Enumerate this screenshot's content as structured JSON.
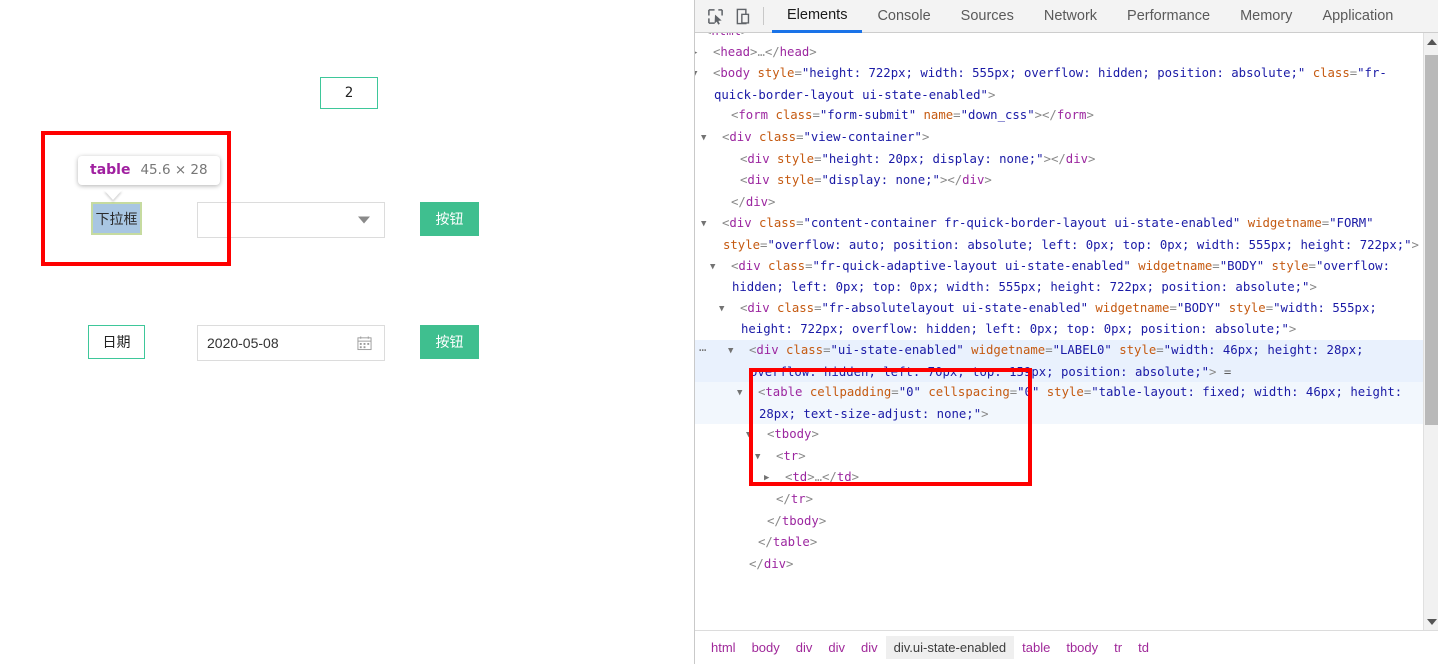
{
  "page": {
    "number_box_value": "2",
    "dropdown_row": {
      "label": "下拉框",
      "select_value": "",
      "caret_icon": "chevron-down-icon",
      "button_label": "按钮"
    },
    "date_row": {
      "label": "日期",
      "date_value": "2020-05-08",
      "calendar_icon": "calendar-icon",
      "button_label": "按钮"
    },
    "inspect_tooltip": {
      "tag": "table",
      "dimensions": "45.6 × 28"
    }
  },
  "devtools": {
    "toolbar": {
      "inspect_icon": "inspect-element-icon",
      "device_icon": "device-toolbar-icon"
    },
    "tabs": [
      {
        "label": "Elements",
        "active": true
      },
      {
        "label": "Console",
        "active": false
      },
      {
        "label": "Sources",
        "active": false
      },
      {
        "label": "Network",
        "active": false
      },
      {
        "label": "Performance",
        "active": false
      },
      {
        "label": "Memory",
        "active": false
      },
      {
        "label": "Application",
        "active": false
      }
    ],
    "dom_lines": [
      {
        "id": "html-cut",
        "indent": 0,
        "triangle": "",
        "parts": [
          {
            "t": "punc",
            "v": "<"
          },
          {
            "t": "tag",
            "v": "html"
          },
          {
            "t": "punc",
            "v": ">"
          }
        ],
        "clipped_top": true
      },
      {
        "id": "head",
        "indent": 1,
        "triangle": "▶",
        "parts": [
          {
            "t": "punc",
            "v": "<"
          },
          {
            "t": "tag",
            "v": "head"
          },
          {
            "t": "punc",
            "v": ">"
          },
          {
            "t": "ellip",
            "v": "…"
          },
          {
            "t": "punc",
            "v": "</"
          },
          {
            "t": "tag",
            "v": "head"
          },
          {
            "t": "punc",
            "v": ">"
          }
        ]
      },
      {
        "id": "body",
        "indent": 1,
        "triangle": "▼",
        "parts": [
          {
            "t": "punc",
            "v": "<"
          },
          {
            "t": "tag",
            "v": "body"
          },
          {
            "t": "plain",
            "v": " "
          },
          {
            "t": "attr",
            "v": "style"
          },
          {
            "t": "punc",
            "v": "="
          },
          {
            "t": "val",
            "v": "\"height: 722px; width: 555px; overflow: hidden; position: absolute;\""
          },
          {
            "t": "plain",
            "v": " "
          },
          {
            "t": "attr",
            "v": "class"
          },
          {
            "t": "punc",
            "v": "="
          },
          {
            "t": "val",
            "v": "\"fr-quick-border-layout ui-state-enabled\""
          },
          {
            "t": "punc",
            "v": ">"
          }
        ]
      },
      {
        "id": "form",
        "indent": 3,
        "triangle": "",
        "parts": [
          {
            "t": "punc",
            "v": "<"
          },
          {
            "t": "tag",
            "v": "form"
          },
          {
            "t": "plain",
            "v": " "
          },
          {
            "t": "attr",
            "v": "class"
          },
          {
            "t": "punc",
            "v": "="
          },
          {
            "t": "val",
            "v": "\"form-submit\""
          },
          {
            "t": "plain",
            "v": " "
          },
          {
            "t": "attr",
            "v": "name"
          },
          {
            "t": "punc",
            "v": "="
          },
          {
            "t": "val",
            "v": "\"down_css\""
          },
          {
            "t": "punc",
            "v": ">"
          },
          {
            "t": "punc",
            "v": "</"
          },
          {
            "t": "tag",
            "v": "form"
          },
          {
            "t": "punc",
            "v": ">"
          }
        ]
      },
      {
        "id": "view-container",
        "indent": 2,
        "triangle": "▼",
        "parts": [
          {
            "t": "punc",
            "v": "<"
          },
          {
            "t": "tag",
            "v": "div"
          },
          {
            "t": "plain",
            "v": " "
          },
          {
            "t": "attr",
            "v": "class"
          },
          {
            "t": "punc",
            "v": "="
          },
          {
            "t": "val",
            "v": "\"view-container\""
          },
          {
            "t": "punc",
            "v": ">"
          }
        ]
      },
      {
        "id": "div-h20",
        "indent": 4,
        "triangle": "",
        "parts": [
          {
            "t": "punc",
            "v": "<"
          },
          {
            "t": "tag",
            "v": "div"
          },
          {
            "t": "plain",
            "v": " "
          },
          {
            "t": "attr",
            "v": "style"
          },
          {
            "t": "punc",
            "v": "="
          },
          {
            "t": "val",
            "v": "\"height: 20px; display: none;\""
          },
          {
            "t": "punc",
            "v": ">"
          },
          {
            "t": "punc",
            "v": "</"
          },
          {
            "t": "tag",
            "v": "div"
          },
          {
            "t": "punc",
            "v": ">"
          }
        ]
      },
      {
        "id": "div-none",
        "indent": 4,
        "triangle": "",
        "parts": [
          {
            "t": "punc",
            "v": "<"
          },
          {
            "t": "tag",
            "v": "div"
          },
          {
            "t": "plain",
            "v": " "
          },
          {
            "t": "attr",
            "v": "style"
          },
          {
            "t": "punc",
            "v": "="
          },
          {
            "t": "val",
            "v": "\"display: none;\""
          },
          {
            "t": "punc",
            "v": ">"
          },
          {
            "t": "punc",
            "v": "</"
          },
          {
            "t": "tag",
            "v": "div"
          },
          {
            "t": "punc",
            "v": ">"
          }
        ]
      },
      {
        "id": "close-view-container",
        "indent": 3,
        "triangle": "",
        "parts": [
          {
            "t": "punc",
            "v": "</"
          },
          {
            "t": "tag",
            "v": "div"
          },
          {
            "t": "punc",
            "v": ">"
          }
        ]
      },
      {
        "id": "content-container",
        "indent": 2,
        "triangle": "▼",
        "parts": [
          {
            "t": "punc",
            "v": "<"
          },
          {
            "t": "tag",
            "v": "div"
          },
          {
            "t": "plain",
            "v": " "
          },
          {
            "t": "attr",
            "v": "class"
          },
          {
            "t": "punc",
            "v": "="
          },
          {
            "t": "val",
            "v": "\"content-container fr-quick-border-layout ui-state-enabled\""
          },
          {
            "t": "plain",
            "v": " "
          },
          {
            "t": "attr",
            "v": "widgetname"
          },
          {
            "t": "punc",
            "v": "="
          },
          {
            "t": "val",
            "v": "\"FORM\""
          },
          {
            "t": "plain",
            "v": " "
          },
          {
            "t": "attr",
            "v": "style"
          },
          {
            "t": "punc",
            "v": "="
          },
          {
            "t": "val",
            "v": "\"overflow: auto; position: absolute; left: 0px; top: 0px; width: 555px; height: 722px;\""
          },
          {
            "t": "punc",
            "v": ">"
          }
        ]
      },
      {
        "id": "adaptive-layout",
        "indent": 3,
        "triangle": "▼",
        "parts": [
          {
            "t": "punc",
            "v": "<"
          },
          {
            "t": "tag",
            "v": "div"
          },
          {
            "t": "plain",
            "v": " "
          },
          {
            "t": "attr",
            "v": "class"
          },
          {
            "t": "punc",
            "v": "="
          },
          {
            "t": "val",
            "v": "\"fr-quick-adaptive-layout ui-state-enabled\""
          },
          {
            "t": "plain",
            "v": " "
          },
          {
            "t": "attr",
            "v": "widgetname"
          },
          {
            "t": "punc",
            "v": "="
          },
          {
            "t": "val",
            "v": "\"BODY\""
          },
          {
            "t": "plain",
            "v": " "
          },
          {
            "t": "attr",
            "v": "style"
          },
          {
            "t": "punc",
            "v": "="
          },
          {
            "t": "val",
            "v": "\"overflow: hidden; left: 0px; top: 0px; width: 555px; height: 722px; position: absolute;\""
          },
          {
            "t": "punc",
            "v": ">"
          }
        ]
      },
      {
        "id": "absolutelayout",
        "indent": 4,
        "triangle": "▼",
        "parts": [
          {
            "t": "punc",
            "v": "<"
          },
          {
            "t": "tag",
            "v": "div"
          },
          {
            "t": "plain",
            "v": " "
          },
          {
            "t": "attr",
            "v": "class"
          },
          {
            "t": "punc",
            "v": "="
          },
          {
            "t": "val",
            "v": "\"fr-absolutelayout ui-state-enabled\""
          },
          {
            "t": "plain",
            "v": " "
          },
          {
            "t": "attr",
            "v": "widgetname"
          },
          {
            "t": "punc",
            "v": "="
          },
          {
            "t": "val",
            "v": "\"BODY\""
          },
          {
            "t": "plain",
            "v": " "
          },
          {
            "t": "attr",
            "v": "style"
          },
          {
            "t": "punc",
            "v": "="
          },
          {
            "t": "val",
            "v": "\"width: 555px; height: 722px; overflow: hidden; left: 0px; top: 0px; position: absolute;\""
          },
          {
            "t": "punc",
            "v": ">"
          }
        ]
      },
      {
        "id": "label0-div",
        "indent": 5,
        "triangle": "▼",
        "selected": true,
        "leading_dots": "⋯",
        "parts": [
          {
            "t": "punc",
            "v": "<"
          },
          {
            "t": "tag",
            "v": "div"
          },
          {
            "t": "plain",
            "v": " "
          },
          {
            "t": "attr",
            "v": "class"
          },
          {
            "t": "punc",
            "v": "="
          },
          {
            "t": "val",
            "v": "\"ui-state-enabled\""
          },
          {
            "t": "plain",
            "v": " "
          },
          {
            "t": "attr",
            "v": "widgetname"
          },
          {
            "t": "punc",
            "v": "="
          },
          {
            "t": "val",
            "v": "\"LABEL0\""
          },
          {
            "t": "plain",
            "v": " "
          },
          {
            "t": "attr",
            "v": "style"
          },
          {
            "t": "punc",
            "v": "="
          },
          {
            "t": "val",
            "v": "\"width: 46px; height: 28px; overflow: hidden; left: 70px; top: 159px; position: absolute;\""
          },
          {
            "t": "punc",
            "v": ">"
          },
          {
            "t": "dollar",
            "v": " ="
          }
        ]
      },
      {
        "id": "table",
        "indent": 6,
        "triangle": "▼",
        "stripe": true,
        "parts": [
          {
            "t": "punc",
            "v": "<"
          },
          {
            "t": "tag",
            "v": "table"
          },
          {
            "t": "plain",
            "v": " "
          },
          {
            "t": "attr",
            "v": "cellpadding"
          },
          {
            "t": "punc",
            "v": "="
          },
          {
            "t": "val",
            "v": "\"0\""
          },
          {
            "t": "plain",
            "v": " "
          },
          {
            "t": "attr",
            "v": "cellspacing"
          },
          {
            "t": "punc",
            "v": "="
          },
          {
            "t": "val",
            "v": "\"0\""
          },
          {
            "t": "plain",
            "v": " "
          },
          {
            "t": "attr",
            "v": "style"
          },
          {
            "t": "punc",
            "v": "="
          },
          {
            "t": "val",
            "v": "\"table-layout: fixed; width: 46px; height: 28px; text-size-adjust: none;\""
          },
          {
            "t": "punc",
            "v": ">"
          }
        ]
      },
      {
        "id": "tbody",
        "indent": 7,
        "triangle": "▼",
        "parts": [
          {
            "t": "punc",
            "v": "<"
          },
          {
            "t": "tag",
            "v": "tbody"
          },
          {
            "t": "punc",
            "v": ">"
          }
        ]
      },
      {
        "id": "tr",
        "indent": 8,
        "triangle": "▼",
        "parts": [
          {
            "t": "punc",
            "v": "<"
          },
          {
            "t": "tag",
            "v": "tr"
          },
          {
            "t": "punc",
            "v": ">"
          }
        ]
      },
      {
        "id": "td",
        "indent": 9,
        "triangle": "▶",
        "parts": [
          {
            "t": "punc",
            "v": "<"
          },
          {
            "t": "tag",
            "v": "td"
          },
          {
            "t": "punc",
            "v": ">"
          },
          {
            "t": "ellip",
            "v": "…"
          },
          {
            "t": "punc",
            "v": "</"
          },
          {
            "t": "tag",
            "v": "td"
          },
          {
            "t": "punc",
            "v": ">"
          }
        ]
      },
      {
        "id": "close-tr",
        "indent": 8,
        "triangle": "",
        "parts": [
          {
            "t": "punc",
            "v": "</"
          },
          {
            "t": "tag",
            "v": "tr"
          },
          {
            "t": "punc",
            "v": ">"
          }
        ]
      },
      {
        "id": "close-tbody",
        "indent": 7,
        "triangle": "",
        "parts": [
          {
            "t": "punc",
            "v": "</"
          },
          {
            "t": "tag",
            "v": "tbody"
          },
          {
            "t": "punc",
            "v": ">"
          }
        ]
      },
      {
        "id": "close-table",
        "indent": 6,
        "triangle": "",
        "parts": [
          {
            "t": "punc",
            "v": "</"
          },
          {
            "t": "tag",
            "v": "table"
          },
          {
            "t": "punc",
            "v": ">"
          }
        ]
      },
      {
        "id": "close-label0",
        "indent": 5,
        "triangle": "",
        "parts": [
          {
            "t": "punc",
            "v": "</"
          },
          {
            "t": "tag",
            "v": "div"
          },
          {
            "t": "punc",
            "v": ">"
          }
        ]
      }
    ],
    "breadcrumb": [
      {
        "label": "html",
        "selected": false
      },
      {
        "label": "body",
        "selected": false
      },
      {
        "label": "div",
        "selected": false
      },
      {
        "label": "div",
        "selected": false
      },
      {
        "label": "div",
        "selected": false
      },
      {
        "label": "div.ui-state-enabled",
        "selected": true
      },
      {
        "label": "table",
        "selected": false
      },
      {
        "label": "tbody",
        "selected": false
      },
      {
        "label": "tr",
        "selected": false
      },
      {
        "label": "td",
        "selected": false
      }
    ],
    "scrollbar": {
      "up_icon": "scroll-up-arrow-icon",
      "down_icon": "scroll-down-arrow-icon"
    }
  },
  "colors": {
    "accent_green": "#3fbf8f",
    "border_green": "#3ec79a",
    "annotation_red": "#fe0000",
    "devtools_active_tab": "#1a73e8",
    "highlight_fill": "#a8c6e2",
    "highlight_border": "#c6dba0",
    "selected_row": "#e9f1fd"
  }
}
